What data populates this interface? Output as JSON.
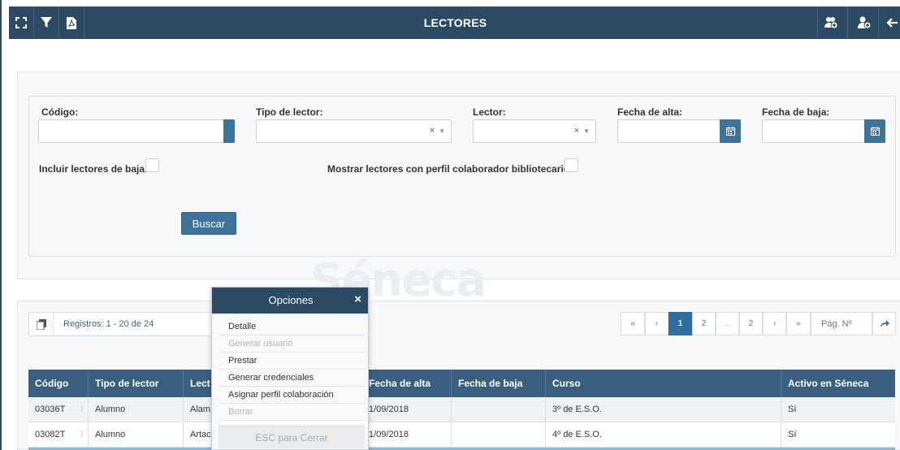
{
  "toolbar": {
    "title": "LECTORES",
    "left_icons": [
      "expand-icon",
      "filter-icon",
      "pdf-icon"
    ],
    "right_icons": [
      "add-group-icon",
      "add-user-icon",
      "back-icon"
    ]
  },
  "filters": {
    "codigo_label": "Código:",
    "tipo_label": "Tipo de lector:",
    "lector_label": "Lector:",
    "fecha_alta_label": "Fecha de alta:",
    "fecha_baja_label": "Fecha de baja:",
    "clear_mark": "×",
    "caret": "▼",
    "incluir_label": "Incluir lectores de baja:",
    "mostrar_label": "Mostrar lectores con perfil colaborador bibliotecario:",
    "buscar_label": "Buscar"
  },
  "watermark": "Séneca",
  "results": {
    "registros": "Registros: 1 - 20 de 24"
  },
  "pagination": {
    "first": "«",
    "prev": "‹",
    "pages": [
      "1",
      "2",
      "...",
      "2"
    ],
    "next": "›",
    "last": "»",
    "page_input_placeholder": "Pág. Nº"
  },
  "table": {
    "columns": [
      "Código",
      "Tipo de lector",
      "Lect",
      "Fecha de alta",
      "Fecha de baja",
      "Curso",
      "Activo en Séneca"
    ],
    "rows": [
      {
        "codigo": "03036T",
        "tipo": "Alumno",
        "lector": "Alam",
        "fecha_alta": "1/09/2018",
        "fecha_baja": "",
        "curso": "3º de E.S.O.",
        "activo": "Sí"
      },
      {
        "codigo": "03082T",
        "tipo": "Alumno",
        "lector": "Artac",
        "fecha_alta": "1/09/2018",
        "fecha_baja": "",
        "curso": "4º de E.S.O.",
        "activo": "Sí"
      }
    ]
  },
  "popup": {
    "title": "Opciones",
    "close": "×",
    "items": [
      {
        "label": "Detalle",
        "enabled": true
      },
      {
        "label": "Generar usuario",
        "enabled": false
      },
      {
        "label": "Prestar",
        "enabled": true
      },
      {
        "label": "Generar credenciales",
        "enabled": true
      },
      {
        "label": "Asignar perfil colaboración",
        "enabled": true
      },
      {
        "label": "Borrar",
        "enabled": false
      }
    ],
    "esc_label": "ESC para Cerrar"
  },
  "colors": {
    "header_bg": "#2d4a65",
    "accent": "#3e739c",
    "table_header": "#3a5f7f"
  }
}
